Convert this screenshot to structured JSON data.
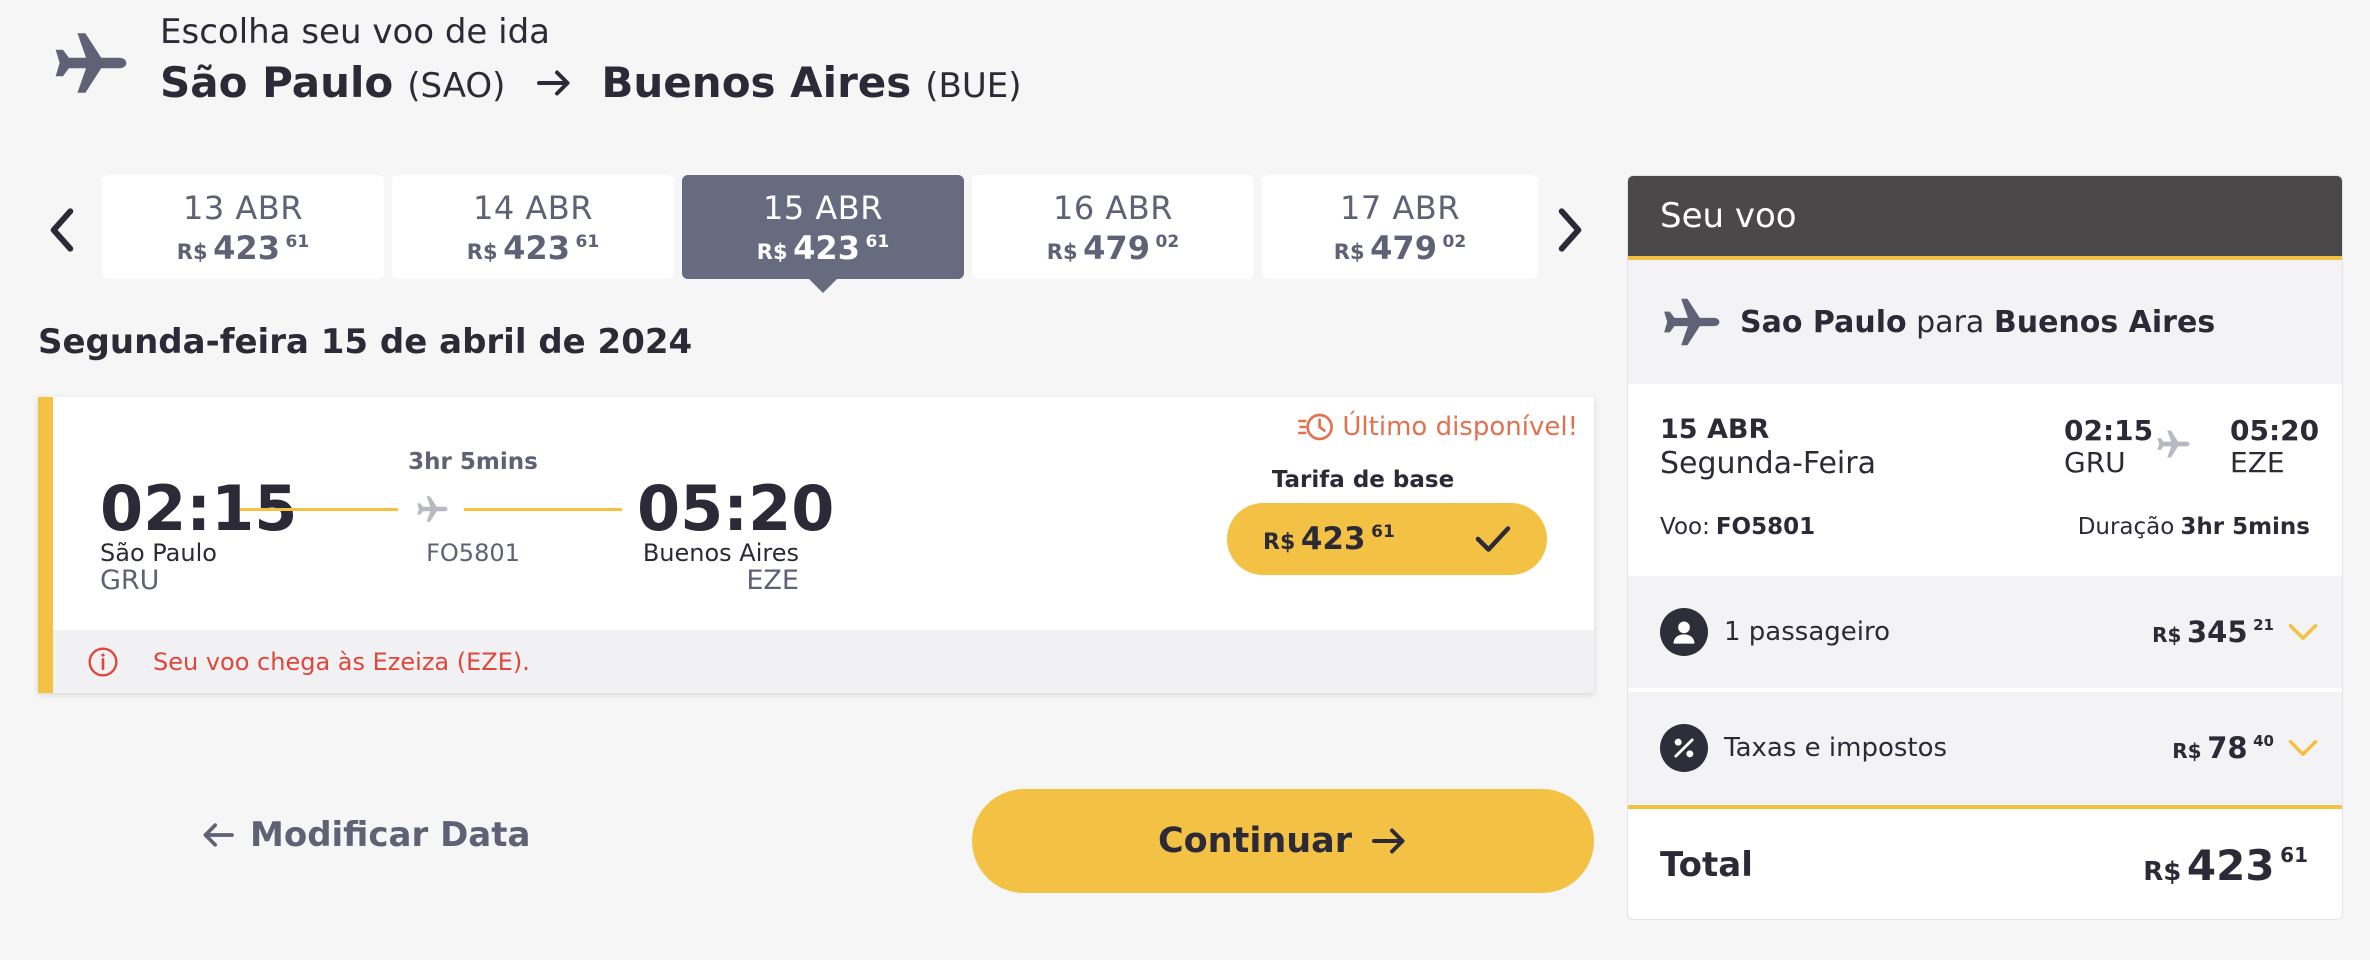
{
  "header": {
    "subtitle": "Escolha seu voo de ida",
    "origin_city": "São Paulo",
    "origin_code": "(SAO)",
    "dest_city": "Buenos Aires",
    "dest_code": "(BUE)"
  },
  "date_tabs": [
    {
      "date": "13 ABR",
      "currency": "R$",
      "int": "423",
      "dec": "61",
      "active": false
    },
    {
      "date": "14 ABR",
      "currency": "R$",
      "int": "423",
      "dec": "61",
      "active": false
    },
    {
      "date": "15 ABR",
      "currency": "R$",
      "int": "423",
      "dec": "61",
      "active": true
    },
    {
      "date": "16 ABR",
      "currency": "R$",
      "int": "479",
      "dec": "02",
      "active": false
    },
    {
      "date": "17 ABR",
      "currency": "R$",
      "int": "479",
      "dec": "02",
      "active": false
    }
  ],
  "day_title": "Segunda-feira 15 de abril de 2024",
  "flight_card": {
    "availability": "Último disponível!",
    "departure_time": "02:15",
    "departure_city": "São Paulo",
    "departure_code": "GRU",
    "duration": "3hr 5mins",
    "flight_number": "FO5801",
    "arrival_time": "05:20",
    "arrival_city": "Buenos Aires",
    "arrival_code": "EZE",
    "fare_label": "Tarifa de base",
    "fare_currency": "R$",
    "fare_int": "423",
    "fare_dec": "61",
    "note": "Seu voo chega às Ezeiza (EZE)."
  },
  "buttons": {
    "modify": "Modificar Data",
    "continue": "Continuar"
  },
  "summary": {
    "title": "Seu voo",
    "route_from": "Sao Paulo",
    "route_connector": "para",
    "route_to": "Buenos Aires",
    "date": "15 ABR",
    "weekday": "Segunda-Feira",
    "dep_time": "02:15",
    "dep_code": "GRU",
    "arr_time": "05:20",
    "arr_code": "EZE",
    "flight_label": "Voo:",
    "flight_number": "FO5801",
    "duration_label": "Duração",
    "duration": "3hr 5mins",
    "passengers_label": "1 passageiro",
    "passengers_currency": "R$",
    "passengers_int": "345",
    "passengers_dec": "21",
    "taxes_label": "Taxas e impostos",
    "taxes_currency": "R$",
    "taxes_int": "78",
    "taxes_dec": "40",
    "total_label": "Total",
    "total_currency": "R$",
    "total_int": "423",
    "total_dec": "61"
  },
  "colors": {
    "accent": "#f3c144",
    "dark": "#2b2a36",
    "tab_active": "#676b80",
    "panel_header": "#4a4849",
    "warning": "#e4704f",
    "error": "#e0463b"
  }
}
